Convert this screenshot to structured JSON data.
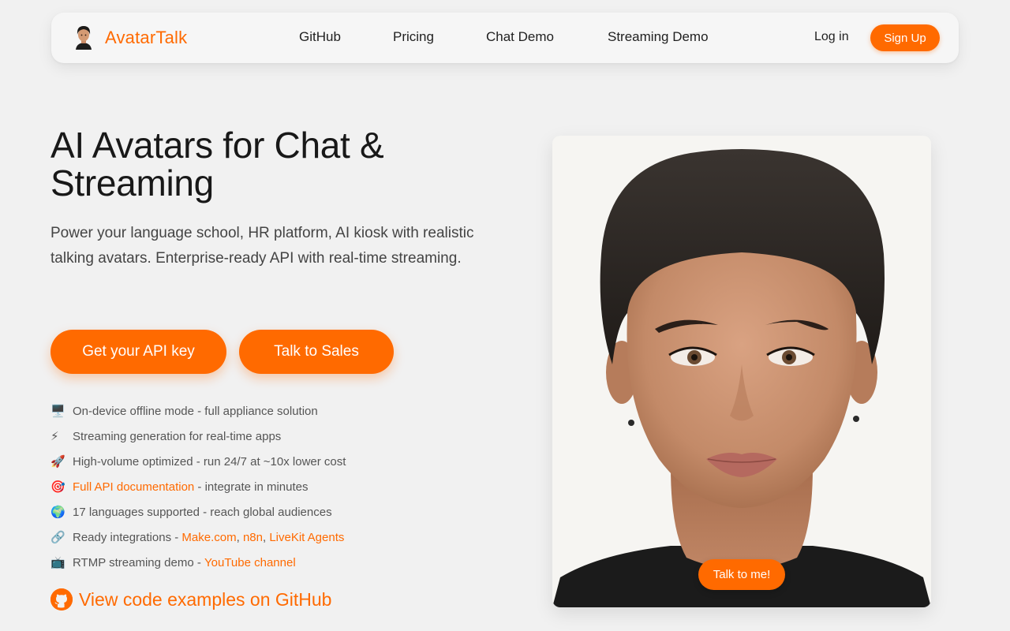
{
  "nav": {
    "brand_name": "AvatarTalk",
    "links": [
      "GitHub",
      "Pricing",
      "Chat Demo",
      "Streaming Demo"
    ],
    "login_label": "Log in",
    "signup_label": "Sign Up"
  },
  "hero": {
    "title": "AI Avatars for Chat & Streaming",
    "subtitle": "Power your language school, HR platform, AI kiosk with realistic talking avatars. Enterprise-ready API with real-time streaming.",
    "primary_button": "Get your API key",
    "secondary_button": "Talk to Sales"
  },
  "features": [
    {
      "icon": "🖥️",
      "icon_name": "desktop-computer-icon",
      "text": "On-device offline mode - full appliance solution"
    },
    {
      "icon": "⚡",
      "icon_name": "lightning-icon",
      "text": "Streaming generation for real-time apps"
    },
    {
      "icon": "🚀",
      "icon_name": "rocket-icon",
      "text": "High-volume optimized - run 24/7 at ~10x lower cost"
    },
    {
      "icon": "🎯",
      "icon_name": "target-icon",
      "link": "Full API documentation",
      "text": " - integrate in minutes"
    },
    {
      "icon": "🌍",
      "icon_name": "globe-icon",
      "text": "17 languages supported - reach global audiences"
    },
    {
      "icon": "🔗",
      "icon_name": "link-icon",
      "text_prefix": "Ready integrations - ",
      "links": [
        "Make.com",
        "n8n",
        "LiveKit Agents"
      ]
    },
    {
      "icon": "📺",
      "icon_name": "television-icon",
      "text_prefix": "RTMP streaming demo - ",
      "link": "YouTube channel"
    }
  ],
  "github_cta": "View code examples on GitHub",
  "avatar_card": {
    "talk_button": "Talk to me!"
  },
  "colors": {
    "accent": "#ff6a00",
    "background": "#f1f1f1",
    "text": "#1a1a1a"
  }
}
